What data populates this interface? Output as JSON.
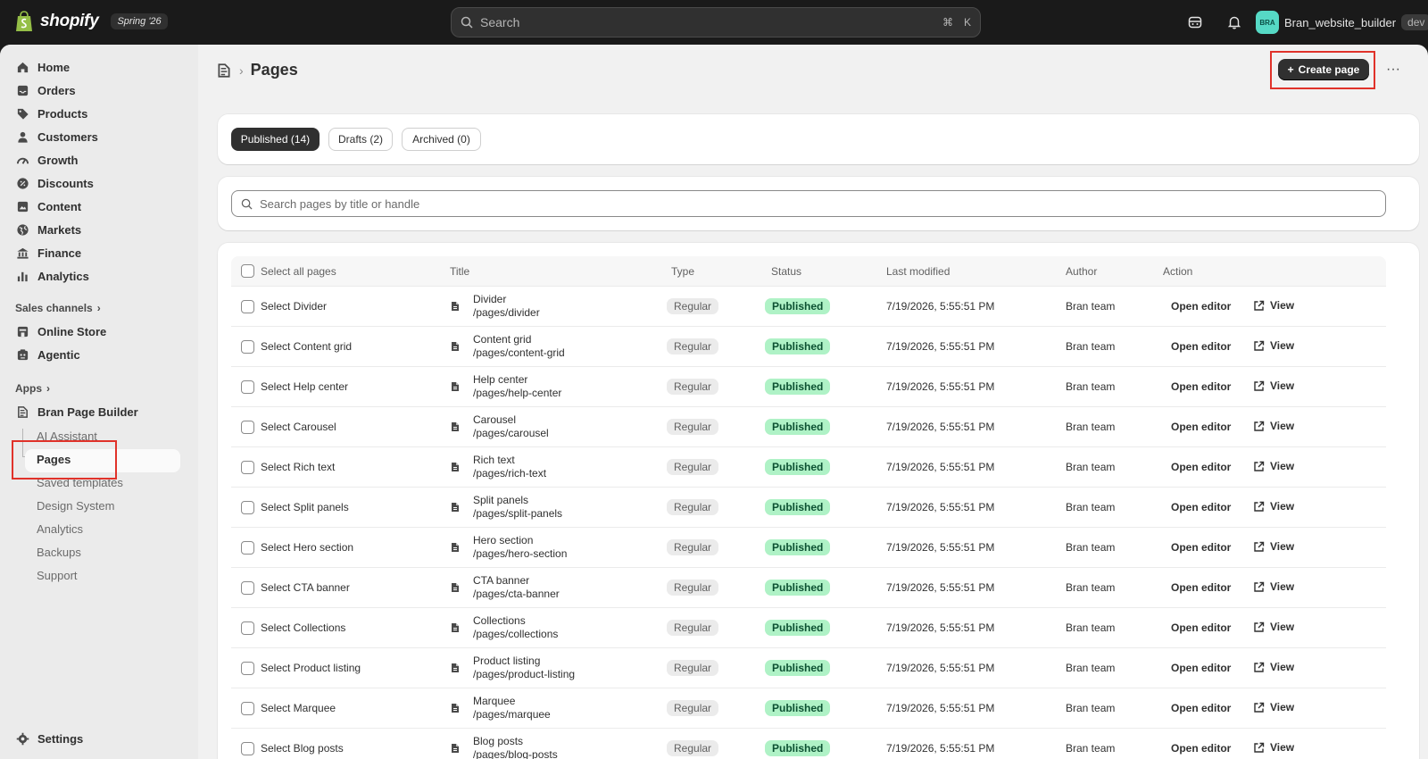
{
  "topbar": {
    "brand": "shopify",
    "edition": "Spring '26",
    "search_label": "Search",
    "shortcut_cmd": "⌘",
    "shortcut_key": "K",
    "store_avatar": "BRA",
    "store_name": "Bran_website_builder",
    "store_badge": "dev"
  },
  "sidebar": {
    "items": [
      "Home",
      "Orders",
      "Products",
      "Customers",
      "Growth",
      "Discounts",
      "Content",
      "Markets",
      "Finance",
      "Analytics"
    ],
    "sales_channels_label": "Sales channels",
    "channels": [
      "Online Store",
      "Agentic"
    ],
    "apps_label": "Apps",
    "app_name": "Bran Page Builder",
    "app_sub": [
      "AI Assistant",
      "Pages",
      "Saved templates",
      "Design System",
      "Analytics",
      "Backups",
      "Support"
    ],
    "settings": "Settings"
  },
  "page": {
    "title": "Pages",
    "create_label": "Create page",
    "more_label": "···",
    "tabs": [
      "Published (14)",
      "Drafts (2)",
      "Archived (0)"
    ],
    "search_placeholder": "Search pages by title or handle"
  },
  "table": {
    "headers": {
      "select_all": "Select all pages",
      "title": "Title",
      "type": "Type",
      "status": "Status",
      "modified": "Last modified",
      "author": "Author",
      "action": "Action"
    },
    "rows": [
      {
        "select": "Select Divider",
        "title": "Divider",
        "handle": "/pages/divider",
        "type": "Regular",
        "status": "Published",
        "modified": "7/19/2026, 5:55:51 PM",
        "author": "Bran team",
        "edit": "Open editor",
        "view": "View"
      },
      {
        "select": "Select Content grid",
        "title": "Content grid",
        "handle": "/pages/content-grid",
        "type": "Regular",
        "status": "Published",
        "modified": "7/19/2026, 5:55:51 PM",
        "author": "Bran team",
        "edit": "Open editor",
        "view": "View"
      },
      {
        "select": "Select Help center",
        "title": "Help center",
        "handle": "/pages/help-center",
        "type": "Regular",
        "status": "Published",
        "modified": "7/19/2026, 5:55:51 PM",
        "author": "Bran team",
        "edit": "Open editor",
        "view": "View"
      },
      {
        "select": "Select Carousel",
        "title": "Carousel",
        "handle": "/pages/carousel",
        "type": "Regular",
        "status": "Published",
        "modified": "7/19/2026, 5:55:51 PM",
        "author": "Bran team",
        "edit": "Open editor",
        "view": "View"
      },
      {
        "select": "Select Rich text",
        "title": "Rich text",
        "handle": "/pages/rich-text",
        "type": "Regular",
        "status": "Published",
        "modified": "7/19/2026, 5:55:51 PM",
        "author": "Bran team",
        "edit": "Open editor",
        "view": "View"
      },
      {
        "select": "Select Split panels",
        "title": "Split panels",
        "handle": "/pages/split-panels",
        "type": "Regular",
        "status": "Published",
        "modified": "7/19/2026, 5:55:51 PM",
        "author": "Bran team",
        "edit": "Open editor",
        "view": "View"
      },
      {
        "select": "Select Hero section",
        "title": "Hero section",
        "handle": "/pages/hero-section",
        "type": "Regular",
        "status": "Published",
        "modified": "7/19/2026, 5:55:51 PM",
        "author": "Bran team",
        "edit": "Open editor",
        "view": "View"
      },
      {
        "select": "Select CTA banner",
        "title": "CTA banner",
        "handle": "/pages/cta-banner",
        "type": "Regular",
        "status": "Published",
        "modified": "7/19/2026, 5:55:51 PM",
        "author": "Bran team",
        "edit": "Open editor",
        "view": "View"
      },
      {
        "select": "Select Collections",
        "title": "Collections",
        "handle": "/pages/collections",
        "type": "Regular",
        "status": "Published",
        "modified": "7/19/2026, 5:55:51 PM",
        "author": "Bran team",
        "edit": "Open editor",
        "view": "View"
      },
      {
        "select": "Select Product listing",
        "title": "Product listing",
        "handle": "/pages/product-listing",
        "type": "Regular",
        "status": "Published",
        "modified": "7/19/2026, 5:55:51 PM",
        "author": "Bran team",
        "edit": "Open editor",
        "view": "View"
      },
      {
        "select": "Select Marquee",
        "title": "Marquee",
        "handle": "/pages/marquee",
        "type": "Regular",
        "status": "Published",
        "modified": "7/19/2026, 5:55:51 PM",
        "author": "Bran team",
        "edit": "Open editor",
        "view": "View"
      },
      {
        "select": "Select Blog posts",
        "title": "Blog posts",
        "handle": "/pages/blog-posts",
        "type": "Regular",
        "status": "Published",
        "modified": "7/19/2026, 5:55:51 PM",
        "author": "Bran team",
        "edit": "Open editor",
        "view": "View"
      }
    ]
  },
  "colors": {
    "accent": "#303030",
    "status_bg": "#aff2c6",
    "status_text": "#0c5132",
    "highlight": "#e0322a"
  }
}
